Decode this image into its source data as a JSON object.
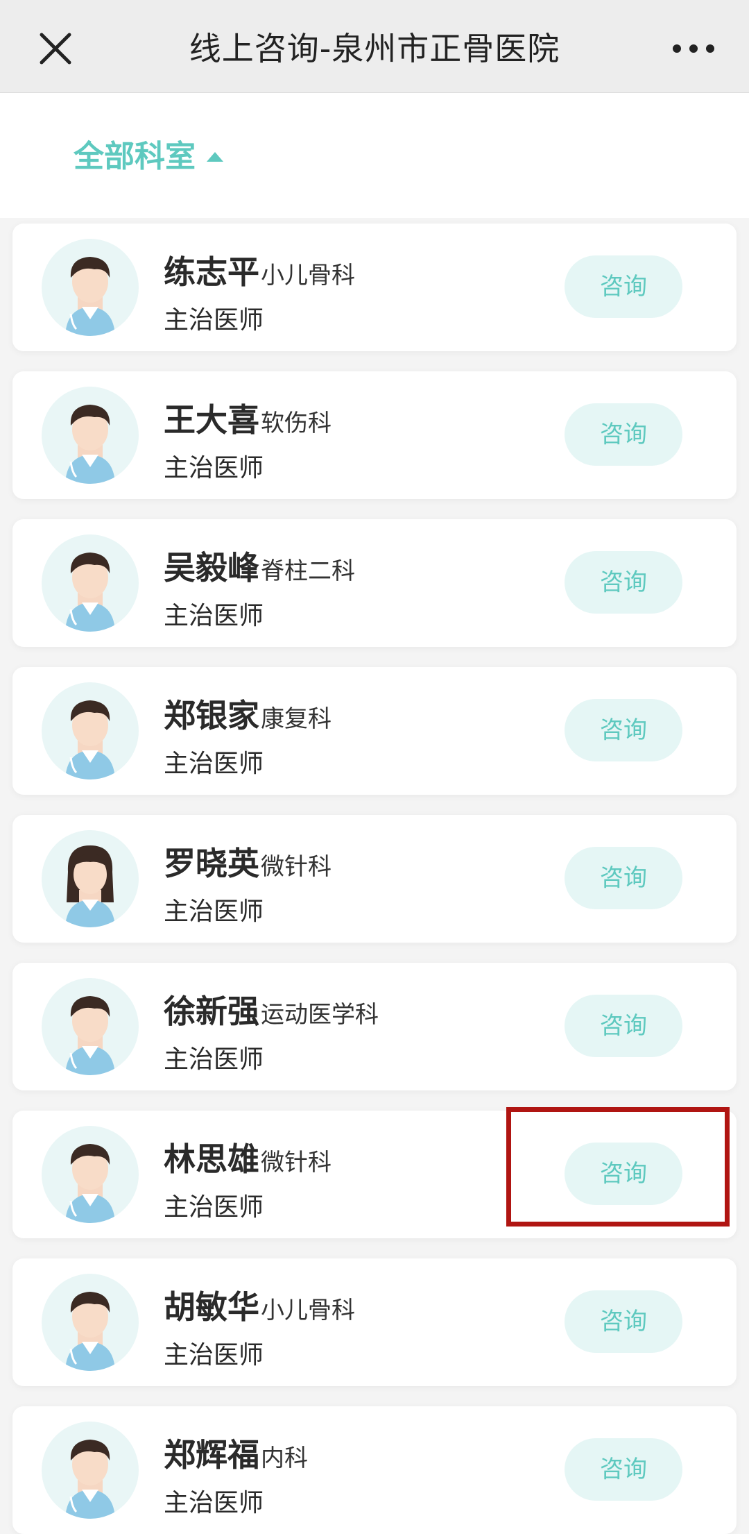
{
  "header": {
    "title": "线上咨询-泉州市正骨医院",
    "close_icon": "close-icon",
    "more_icon": "more-dots-icon"
  },
  "filter": {
    "label": "全部科室"
  },
  "colors": {
    "accent": "#5ec9bf",
    "button_bg": "#e5f6f5",
    "highlight": "#b01512"
  },
  "doctors": [
    {
      "name": "练志平",
      "dept": "小儿骨科",
      "title": "主治医师",
      "button": "咨询",
      "gender": "male"
    },
    {
      "name": "王大喜",
      "dept": "软伤科",
      "title": "主治医师",
      "button": "咨询",
      "gender": "male"
    },
    {
      "name": "吴毅峰",
      "dept": "脊柱二科",
      "title": "主治医师",
      "button": "咨询",
      "gender": "male"
    },
    {
      "name": "郑银家",
      "dept": "康复科",
      "title": "主治医师",
      "button": "咨询",
      "gender": "male"
    },
    {
      "name": "罗晓英",
      "dept": "微针科",
      "title": "主治医师",
      "button": "咨询",
      "gender": "female"
    },
    {
      "name": "徐新强",
      "dept": "运动医学科",
      "title": "主治医师",
      "button": "咨询",
      "gender": "male"
    },
    {
      "name": "林思雄",
      "dept": "微针科",
      "title": "主治医师",
      "button": "咨询",
      "gender": "male"
    },
    {
      "name": "胡敏华",
      "dept": "小儿骨科",
      "title": "主治医师",
      "button": "咨询",
      "gender": "male"
    },
    {
      "name": "郑辉福",
      "dept": "内科",
      "title": "主治医师",
      "button": "咨询",
      "gender": "male"
    }
  ]
}
